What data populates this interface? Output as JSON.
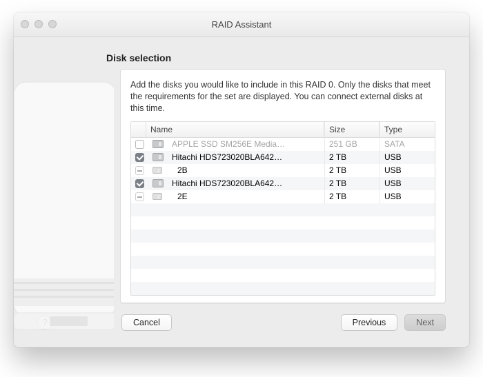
{
  "window": {
    "title": "RAID Assistant"
  },
  "page": {
    "heading": "Disk selection",
    "intro": "Add the disks you would like to include in this RAID 0. Only the disks that meet the requirements for the set are displayed. You can connect external disks at this time.",
    "columns": {
      "name": "Name",
      "size": "Size",
      "type": "Type"
    }
  },
  "disks": [
    {
      "name": "APPLE SSD SM256E Media…",
      "size": "251 GB",
      "type": "SATA",
      "checked": "unchecked",
      "enabled": false,
      "indent": 0,
      "icon": "hdd"
    },
    {
      "name": "Hitachi HDS723020BLA642…",
      "size": "2 TB",
      "type": "USB",
      "checked": "checked",
      "enabled": true,
      "indent": 0,
      "icon": "hdd"
    },
    {
      "name": "2B",
      "size": "2 TB",
      "type": "USB",
      "checked": "dash",
      "enabled": true,
      "indent": 1,
      "icon": "hdd-small"
    },
    {
      "name": "Hitachi HDS723020BLA642…",
      "size": "2 TB",
      "type": "USB",
      "checked": "checked",
      "enabled": true,
      "indent": 0,
      "icon": "hdd"
    },
    {
      "name": "2E",
      "size": "2 TB",
      "type": "USB",
      "checked": "dash",
      "enabled": true,
      "indent": 1,
      "icon": "hdd-small"
    }
  ],
  "buttons": {
    "help": "?",
    "cancel": "Cancel",
    "previous": "Previous",
    "next": "Next"
  }
}
